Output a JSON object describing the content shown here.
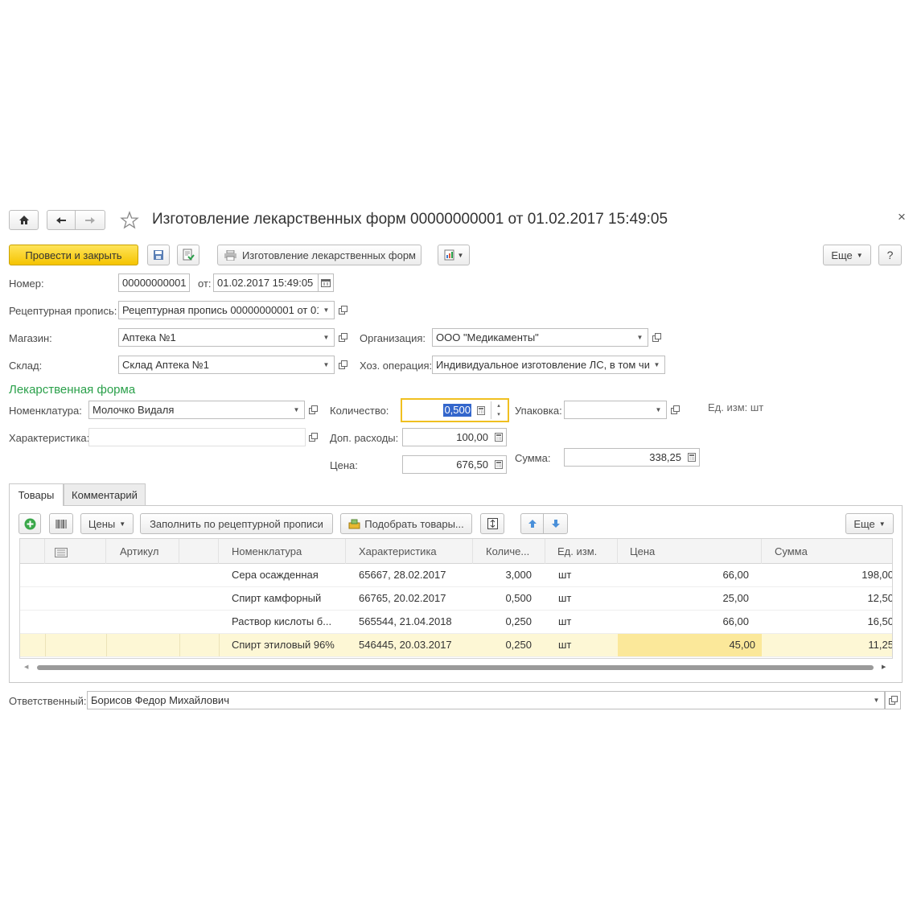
{
  "window": {
    "title": "Изготовление лекарственных форм 00000000001 от 01.02.2017 15:49:05",
    "close_glyph": "×"
  },
  "toolbar": {
    "post_close": "Провести и закрыть",
    "print_label": "Изготовление лекарственных форм",
    "more": "Еще",
    "help": "?"
  },
  "form": {
    "number_label": "Номер:",
    "number_value": "00000000001",
    "date_label": "от:",
    "date_value": "01.02.2017 15:49:05",
    "recipe_label": "Рецептурная пропись:",
    "recipe_value": "Рецептурная пропись 00000000001 от 01",
    "store_label": "Магазин:",
    "store_value": "Аптека №1",
    "org_label": "Организация:",
    "org_value": "ООО \"Медикаменты\"",
    "warehouse_label": "Склад:",
    "warehouse_value": "Склад Аптека №1",
    "operation_label": "Хоз. операция:",
    "operation_value": "Индивидуальное изготовление ЛС, в том чи"
  },
  "drug_form": {
    "section_title": "Лекарственная форма",
    "nomenclature_label": "Номенклатура:",
    "nomenclature_value": "Молочко Видаля",
    "quantity_label": "Количество:",
    "quantity_value": "0,500",
    "package_label": "Упаковка:",
    "package_value": "",
    "unit_label": "Ед. изм: шт",
    "characteristic_label": "Характеристика:",
    "characteristic_value": "",
    "extra_label": "Доп. расходы:",
    "extra_value": "100,00",
    "price_label": "Цена:",
    "price_value": "676,50",
    "sum_label": "Сумма:",
    "sum_value": "338,25"
  },
  "tabs": [
    {
      "label": "Товары"
    },
    {
      "label": "Комментарий"
    }
  ],
  "table_toolbar": {
    "prices": "Цены",
    "fill": "Заполнить по рецептурной прописи",
    "pick": "Подобрать товары...",
    "more": "Еще"
  },
  "table": {
    "columns": [
      "Артикул",
      "Номенклатура",
      "Характеристика",
      "Количе...",
      "Ед. изм.",
      "Цена",
      "Сумма"
    ],
    "rows": [
      {
        "nom": "Сера осажденная",
        "char": "65667, 28.02.2017",
        "qty": "3,000",
        "unit": "шт",
        "price": "66,00",
        "sum": "198,00"
      },
      {
        "nom": "Спирт камфорный",
        "char": "66765, 20.02.2017",
        "qty": "0,500",
        "unit": "шт",
        "price": "25,00",
        "sum": "12,50"
      },
      {
        "nom": "Раствор кислоты б...",
        "char": "565544, 21.04.2018",
        "qty": "0,250",
        "unit": "шт",
        "price": "66,00",
        "sum": "16,50"
      },
      {
        "nom": "Спирт этиловый 96%",
        "char": "546445, 20.03.2017",
        "qty": "0,250",
        "unit": "шт",
        "price": "45,00",
        "sum": "11,25"
      }
    ],
    "selected_row": 3
  },
  "footer": {
    "responsible_label": "Ответственный:",
    "responsible_value": "Борисов Федор Михайлович"
  },
  "colors": {
    "primary": "#f5c400",
    "section": "#2aa04a",
    "selected_row": "#fdf7d5",
    "selected_cell": "#fbe89a",
    "focus_border": "#f0c020"
  }
}
